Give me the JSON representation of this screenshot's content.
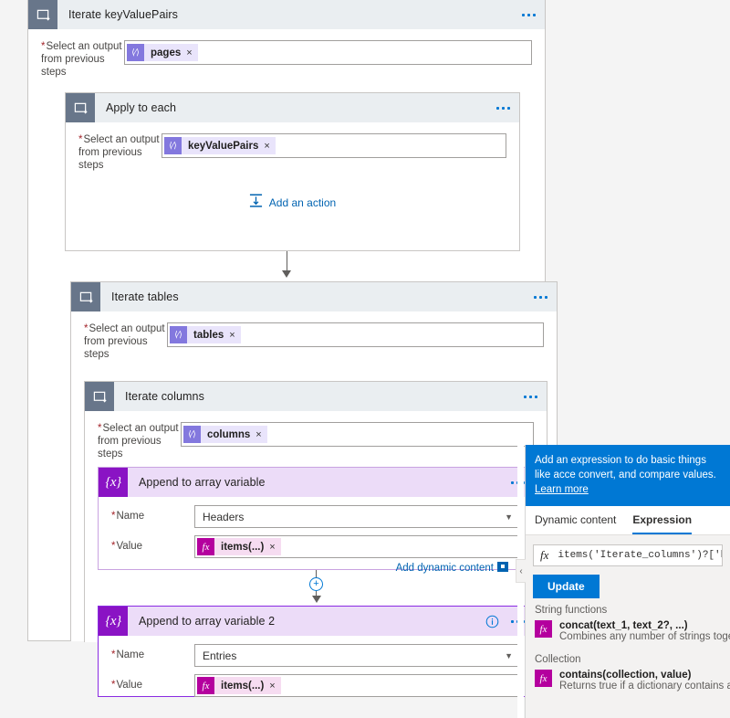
{
  "designer": {
    "outer_loop": {
      "title": "Iterate keyValuePairs",
      "icon": "foreach-loop-icon",
      "menu": "more-commands",
      "field": {
        "label_line1": "Select an output",
        "label_line2": "from previous steps",
        "required": "*",
        "token": {
          "text": "pages",
          "remove": "×",
          "icon": "dynamic-content-icon"
        }
      }
    },
    "apply_to_each": {
      "title": "Apply to each",
      "field": {
        "label_line1": "Select an output",
        "label_line2": "from previous steps",
        "required": "*",
        "token": {
          "text": "keyValuePairs",
          "remove": "×",
          "icon": "dynamic-content-icon"
        }
      },
      "add_action_label": "Add an action"
    },
    "iterate_tables": {
      "title": "Iterate tables",
      "field": {
        "label_line1": "Select an output",
        "label_line2": "from previous steps",
        "required": "*",
        "token": {
          "text": "tables",
          "remove": "×",
          "icon": "dynamic-content-icon"
        }
      }
    },
    "iterate_columns": {
      "title": "Iterate columns",
      "field": {
        "label_line1": "Select an output",
        "label_line2": "from previous steps",
        "required": "*",
        "token": {
          "text": "columns",
          "remove": "×",
          "icon": "dynamic-content-icon"
        }
      }
    },
    "append_headers": {
      "title": "Append to array variable",
      "icon": "variable-braces-icon",
      "name_label": "Name",
      "name_value": "Headers",
      "value_label": "Value",
      "value_token": {
        "text": "items(...)",
        "remove": "×",
        "icon": "expression-fx-icon"
      },
      "add_dynamic_content": "Add dynamic content"
    },
    "append_entries": {
      "title": "Append to array variable 2",
      "icon": "variable-braces-icon",
      "info_icon": "info-icon",
      "name_label": "Name",
      "name_value": "Entries",
      "value_label": "Value",
      "value_token": {
        "text": "items(...)",
        "remove": "×",
        "icon": "expression-fx-icon"
      }
    },
    "required_marker": "*",
    "insert_button": "+"
  },
  "expression_panel": {
    "banner_text": "Add an expression to do basic things like acce convert, and compare values.",
    "banner_line1": "Add an expression to do basic things like acce",
    "banner_line2": "convert, and compare values.",
    "banner_link": "Learn more",
    "tabs": [
      {
        "label": "Dynamic content",
        "active": false
      },
      {
        "label": "Expression",
        "active": true
      }
    ],
    "expression_value": "items('Iterate_columns')?['he",
    "fx_glyph": "fx",
    "update_button": "Update",
    "groups": [
      {
        "name": "String functions",
        "items": [
          {
            "signature": "concat(text_1, text_2?, ...)",
            "description": "Combines any number of strings togethe"
          }
        ]
      },
      {
        "name": "Collection",
        "items": [
          {
            "signature": "contains(collection, value)",
            "description": "Returns true if a dictionary contains a ke"
          }
        ]
      }
    ],
    "collapse_glyph": "‹"
  },
  "colors": {
    "accent": "#0078d4",
    "loop_header_icon": "#68768a",
    "variable_icon": "#8a13c4",
    "dynamic_token": "#8378de",
    "expression_token": "#b4009e",
    "required": "#a4262c",
    "selected_border": "#8a2be2"
  }
}
